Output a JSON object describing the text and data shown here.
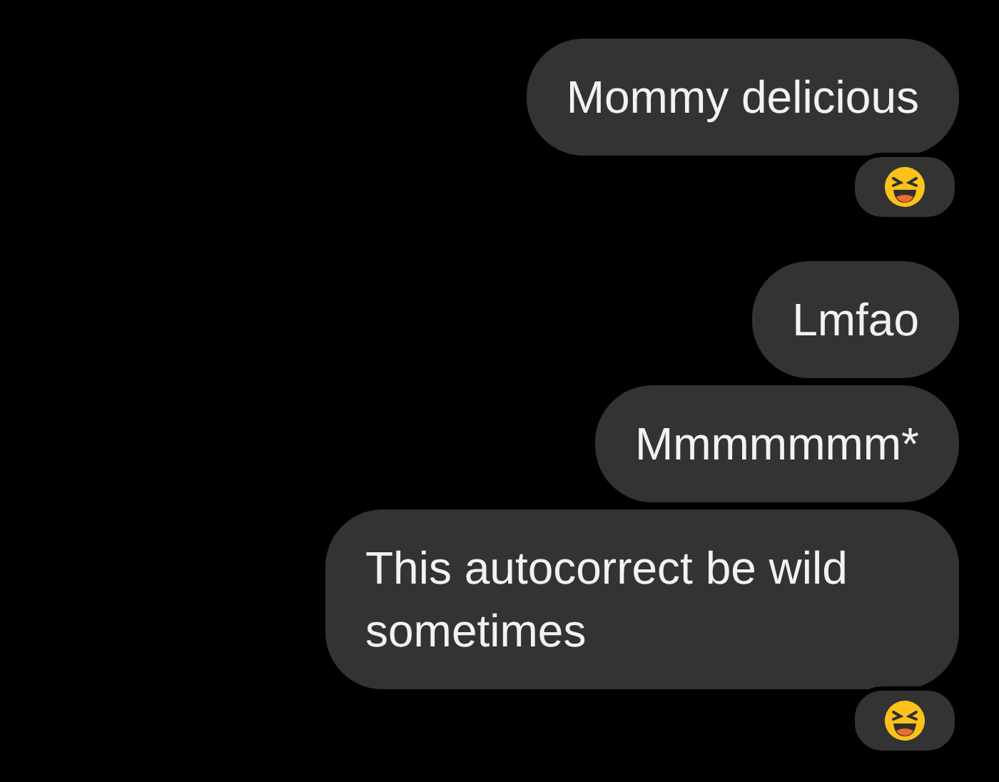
{
  "messages": [
    {
      "text": "Mommy delicious",
      "reacted": true
    },
    {
      "text": "Lmfao",
      "reacted": false
    },
    {
      "text": "Mmmmmmm*",
      "reacted": false
    },
    {
      "text": "This autocorrect be wild sometimes",
      "reacted": true
    }
  ]
}
